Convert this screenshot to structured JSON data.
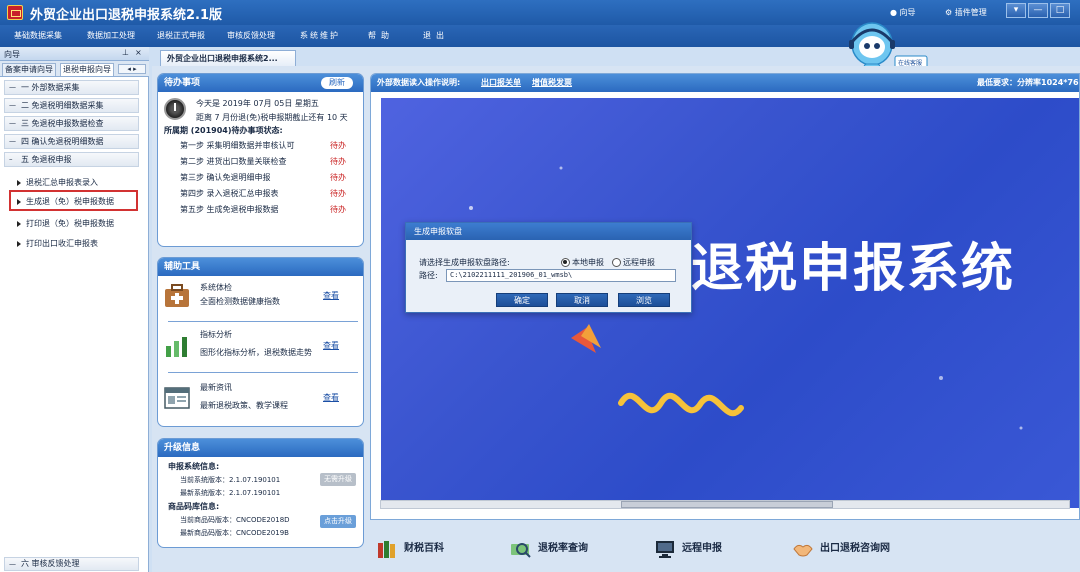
{
  "app": {
    "title": "外贸企业出口退税申报系统2.1版"
  },
  "topbar": {
    "guide": "向导",
    "plugins": "插件管理",
    "win_min": "—",
    "win_max": "□",
    "win_close": "✕"
  },
  "menu": [
    "基础数据采集",
    "数据加工处理",
    "退税正式申报",
    "审核反馈处理",
    "系统维护",
    "帮助",
    "退出"
  ],
  "left_panel": {
    "title": "向导",
    "pin": "⊥",
    "close": "×",
    "tabs": [
      "备案申请向导",
      "退税申报向导"
    ],
    "arrows": "◂ ▸",
    "steps": [
      "一  外部数据采集",
      "二  免退税明细数据采集",
      "三  免退税申报数据检查",
      "四  确认免退税明细数据",
      "五  免退税申报"
    ],
    "sub_items": [
      "退税汇总申报表录入",
      "生成退（免）税申报数据",
      "打印退（免）税申报数据",
      "打印出口收汇申报表"
    ],
    "bottom_step": "六  审核反馈处理"
  },
  "doc_tab": "外贸企业出口退税申报系统2...",
  "todo": {
    "title": "待办事项",
    "refresh": "刷新",
    "date_line": "今天是 2019年 07月 05日 星期五",
    "deadline_line": "距离 7 月份退(免)税申报期截止还有 10 天",
    "period_line": "所属期 (201904)待办事项状态:",
    "steps": [
      {
        "label": "第一步  采集明细数据并审核认可",
        "status": "待办"
      },
      {
        "label": "第二步  进货出口数量关联检查",
        "status": "待办"
      },
      {
        "label": "第三步  确认免退明细申报",
        "status": "待办"
      },
      {
        "label": "第四步  录入退税汇总申报表",
        "status": "待办"
      },
      {
        "label": "第五步  生成免退税申报数据",
        "status": "待办"
      }
    ]
  },
  "tools": {
    "title": "辅助工具",
    "items": [
      {
        "name": "系统体检",
        "desc": "全面检测数据健康指数",
        "link": "查看"
      },
      {
        "name": "指标分析",
        "desc": "图形化指标分析，退税数据走势",
        "link": "查看"
      },
      {
        "name": "最新资讯",
        "desc": "最新退税政策、教学课程",
        "link": "查看"
      }
    ]
  },
  "upgrade": {
    "title": "升级信息",
    "sys_head": "申报系统信息:",
    "sys_current": "当前系统版本：2.1.07.190101",
    "sys_latest": "最新系统版本：2.1.07.190101",
    "sys_btn": "无需升级",
    "code_head": "商品码库信息:",
    "code_current": "当前商品码版本：CNCODE2018D",
    "code_latest": "最新商品码版本：CNCODE2019B",
    "code_btn": "点击升级"
  },
  "banner": {
    "head": "外部数据读入操作说明:",
    "link1": "出口报关单",
    "link2": "增值税发票",
    "requirement": "最低要求：分辨率1024*768",
    "big_text": "退税申报系统"
  },
  "dialog": {
    "title": "生成申报软盘",
    "prompt": "请选择生成申报软盘路径:",
    "radio_local": "本地申报",
    "radio_remote": "远程申报",
    "path_label": "路径:",
    "path_value": "C:\\2102211111_201906_01_wmsb\\",
    "ok": "确定",
    "cancel": "取消",
    "browse": "浏览"
  },
  "bottom_bar": [
    "财税百科",
    "退税率查询",
    "远程申报",
    "出口退税咨询网"
  ],
  "mascot_badge": "在线客服",
  "colors": {
    "titlebar": "#2166b5",
    "card_head": "#3a7ccc",
    "highlight": "#d23232",
    "banner": "#3a55cf"
  }
}
